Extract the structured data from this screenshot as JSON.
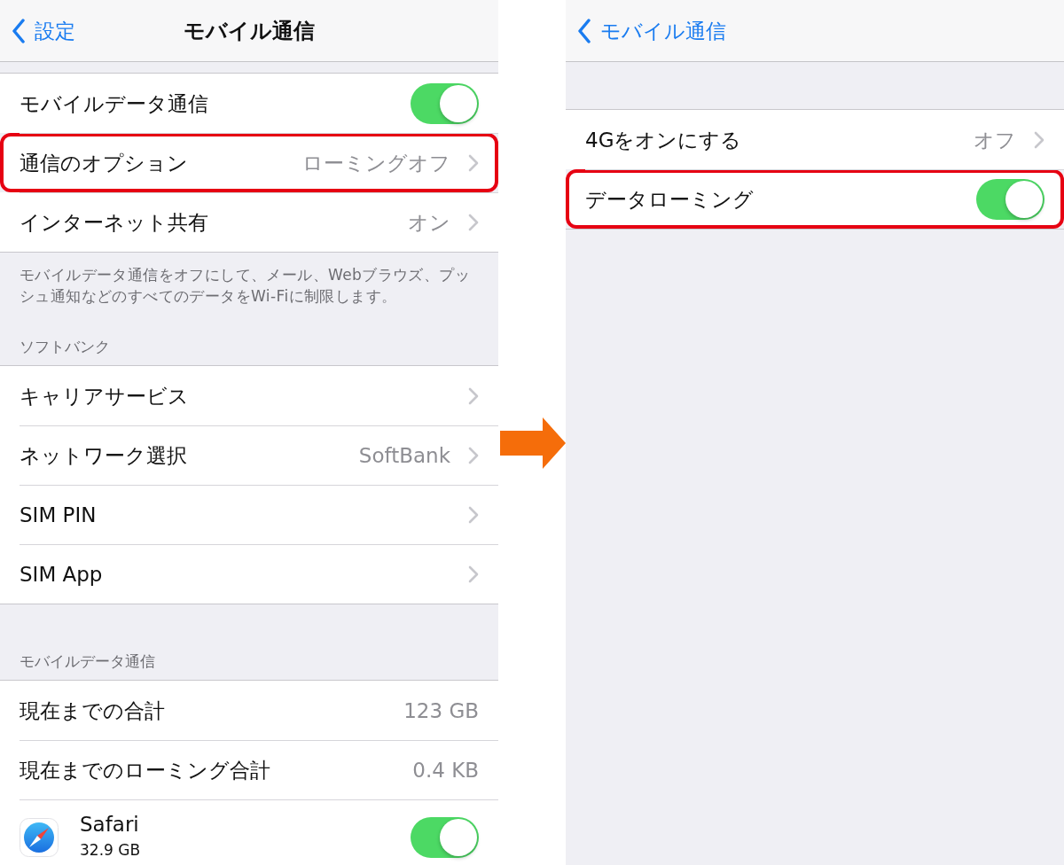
{
  "screens": [
    {
      "nav": {
        "back": "設定",
        "title": "モバイル通信"
      },
      "sections": [
        {
          "rows": [
            {
              "kind": "toggle",
              "label": "モバイルデータ通信",
              "on": true,
              "highlighted": false
            },
            {
              "kind": "link",
              "label": "通信のオプション",
              "value": "ローミングオフ",
              "highlighted": true
            },
            {
              "kind": "link",
              "label": "インターネット共有",
              "value": "オン",
              "highlighted": false
            }
          ],
          "footer": "モバイルデータ通信をオフにして、メール、Webブラウズ、プッシュ通知などのすべてのデータをWi-Fiに制限します。"
        },
        {
          "header": "ソフトバンク",
          "rows": [
            {
              "kind": "link",
              "label": "キャリアサービス",
              "highlighted": false
            },
            {
              "kind": "link",
              "label": "ネットワーク選択",
              "value": "SoftBank",
              "highlighted": false
            },
            {
              "kind": "link",
              "label": "SIM PIN",
              "highlighted": false
            },
            {
              "kind": "link",
              "label": "SIM App",
              "highlighted": false
            }
          ]
        },
        {
          "header": "モバイルデータ通信",
          "rows": [
            {
              "kind": "value",
              "label": "現在までの合計",
              "value": "123 GB",
              "highlighted": false
            },
            {
              "kind": "value",
              "label": "現在までのローミング合計",
              "value": "0.4 KB",
              "highlighted": false
            },
            {
              "kind": "app",
              "label": "Safari",
              "detail": "32.9 GB",
              "on": true,
              "highlighted": false
            }
          ]
        }
      ]
    },
    {
      "nav": {
        "back": "モバイル通信"
      },
      "sections": [
        {
          "rows": [
            {
              "kind": "link",
              "label": "4Gをオンにする",
              "value": "オフ",
              "highlighted": false
            },
            {
              "kind": "toggle",
              "label": "データローミング",
              "on": true,
              "highlighted": true
            }
          ]
        }
      ]
    }
  ]
}
